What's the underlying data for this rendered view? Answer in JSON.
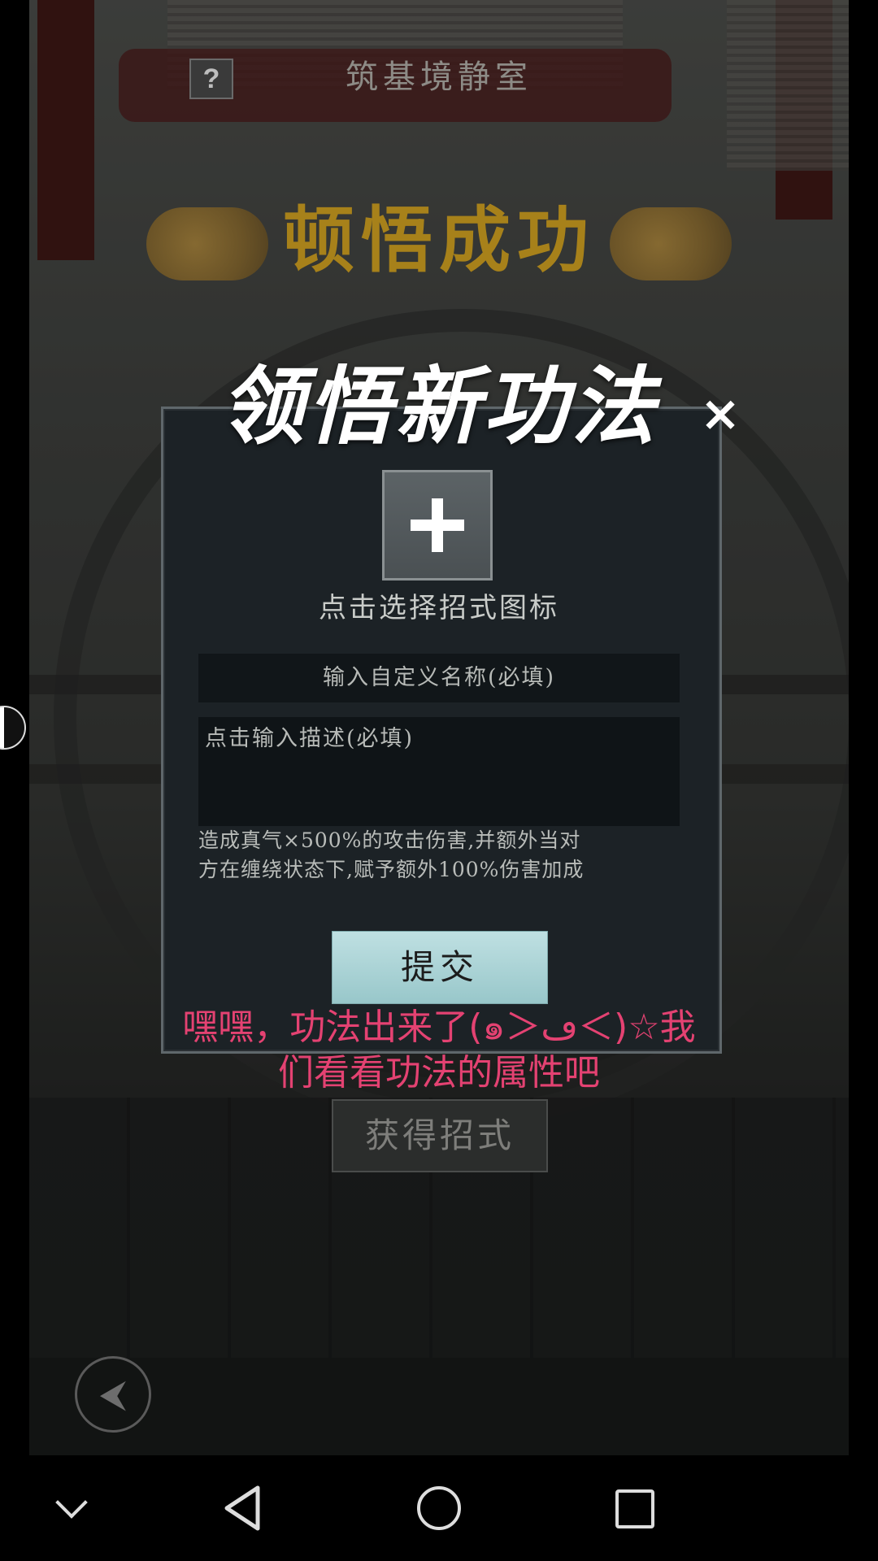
{
  "header": {
    "help_icon_label": "?",
    "room_title": "筑基境静室",
    "success_title": "顿悟成功"
  },
  "dialog": {
    "title": "领悟新功法",
    "close_label": "×",
    "icon_hint": "点击选择招式图标",
    "name_placeholder": "输入自定义名称(必填)",
    "desc_placeholder": "点击输入描述(必填)",
    "skill_desc_line1": "造成真气×500%的攻击伤害,并额外当对",
    "skill_desc_line2": "方在缠绕状态下,赋予额外100%伤害加成",
    "submit_label": "提交"
  },
  "caption": {
    "line1": "嘿嘿，功法出来了(๑＞ڡ＜)☆我",
    "line2": "们看看功法的属性吧"
  },
  "obtain_button_label": "获得招式",
  "back_button_label": "⮜",
  "nav_bar": {
    "icons": [
      "chevron-down-icon",
      "back-triangle-icon",
      "home-circle-icon",
      "recents-square-icon"
    ]
  },
  "colors": {
    "caption": "#e44272",
    "submit_bg": "#98c7ca",
    "dialog_bg": "#1c2226",
    "success_gold": "#b48a18"
  }
}
